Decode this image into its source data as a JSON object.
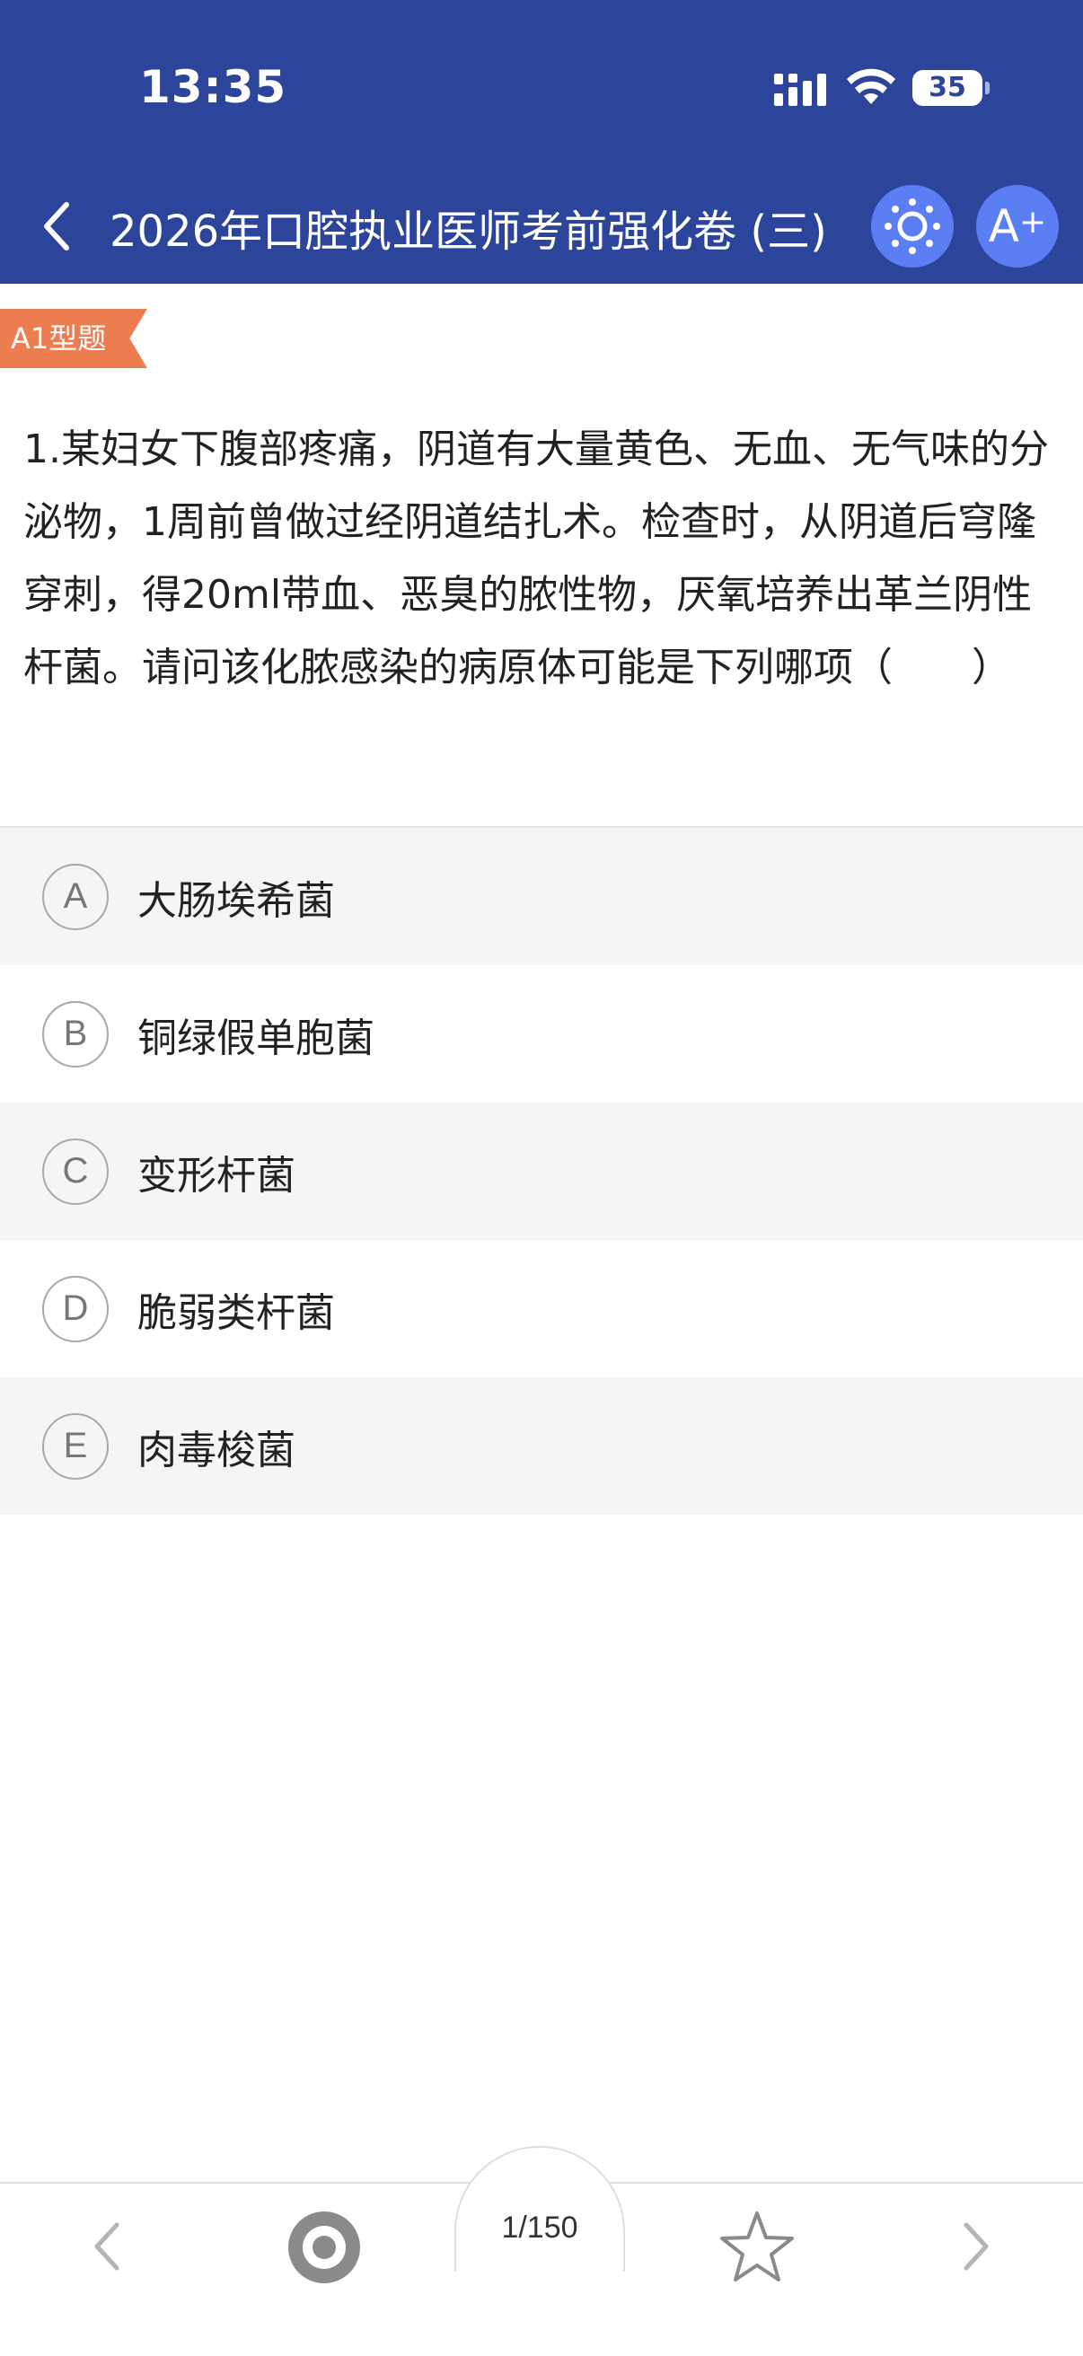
{
  "status_bar": {
    "time": "13:35",
    "battery": "35"
  },
  "header": {
    "title": "2026年口腔执业医师考前强化卷 (三)",
    "font_button": "A",
    "font_button_plus": "+"
  },
  "question": {
    "type_tag": "A1型题",
    "text": "1.某妇女下腹部疼痛，阴道有大量黄色、无血、无气味的分泌物，1周前曾做过经阴道结扎术。检查时，从阴道后穹隆穿刺，得20ml带血、恶臭的脓性物，厌氧培养出革兰阴性杆菌。请问该化脓感染的病原体可能是下列哪项（　　）"
  },
  "options": [
    {
      "letter": "A",
      "text": "大肠埃希菌"
    },
    {
      "letter": "B",
      "text": "铜绿假单胞菌"
    },
    {
      "letter": "C",
      "text": "变形杆菌"
    },
    {
      "letter": "D",
      "text": "脆弱类杆菌"
    },
    {
      "letter": "E",
      "text": "肉毒梭菌"
    }
  ],
  "bottom_bar": {
    "progress": "1/150"
  },
  "colors": {
    "header_bg": "#2c459a",
    "accent": "#5b7ff2",
    "tag": "#eb7d50"
  },
  "icons": [
    "back-icon",
    "brightness-icon",
    "font-size-icon",
    "signal-icon",
    "wifi-icon",
    "prev-icon",
    "eye-icon",
    "star-icon",
    "next-icon"
  ]
}
